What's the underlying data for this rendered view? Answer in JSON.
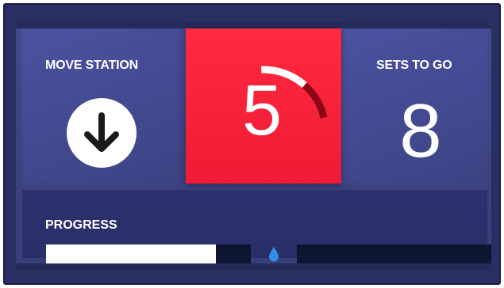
{
  "move_station": {
    "label": "MOVE STATION",
    "icon": "arrow-down-icon"
  },
  "timer": {
    "value": "5",
    "ring_progress": 0.22,
    "color": "#ef1a35"
  },
  "sets_to_go": {
    "label": "SETS TO GO",
    "value": "8"
  },
  "progress": {
    "label": "PROGRESS",
    "segment_1_fraction": 0.83,
    "marker_icon": "droplet-icon",
    "marker_color": "#2f8fe8"
  },
  "colors": {
    "background": "#3b427f",
    "accent": "#ef1a35",
    "track": "#0e1530"
  }
}
